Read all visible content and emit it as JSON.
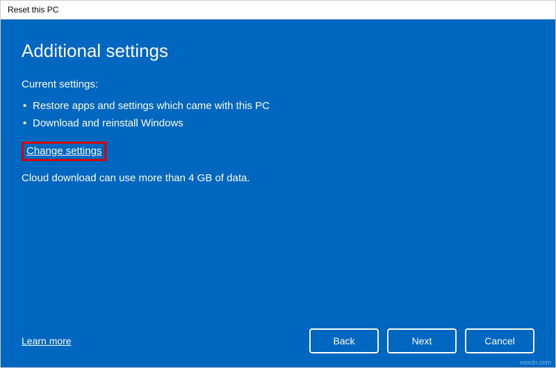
{
  "window": {
    "title": "Reset this PC"
  },
  "main": {
    "heading": "Additional settings",
    "subheading": "Current settings:",
    "bullets": [
      "Restore apps and settings which came with this PC",
      "Download and reinstall Windows"
    ],
    "change_link": "Change settings",
    "note": "Cloud download can use more than 4 GB of data."
  },
  "footer": {
    "learn_more": "Learn more",
    "buttons": {
      "back": "Back",
      "next": "Next",
      "cancel": "Cancel"
    }
  },
  "watermark": "wsxdn.com"
}
